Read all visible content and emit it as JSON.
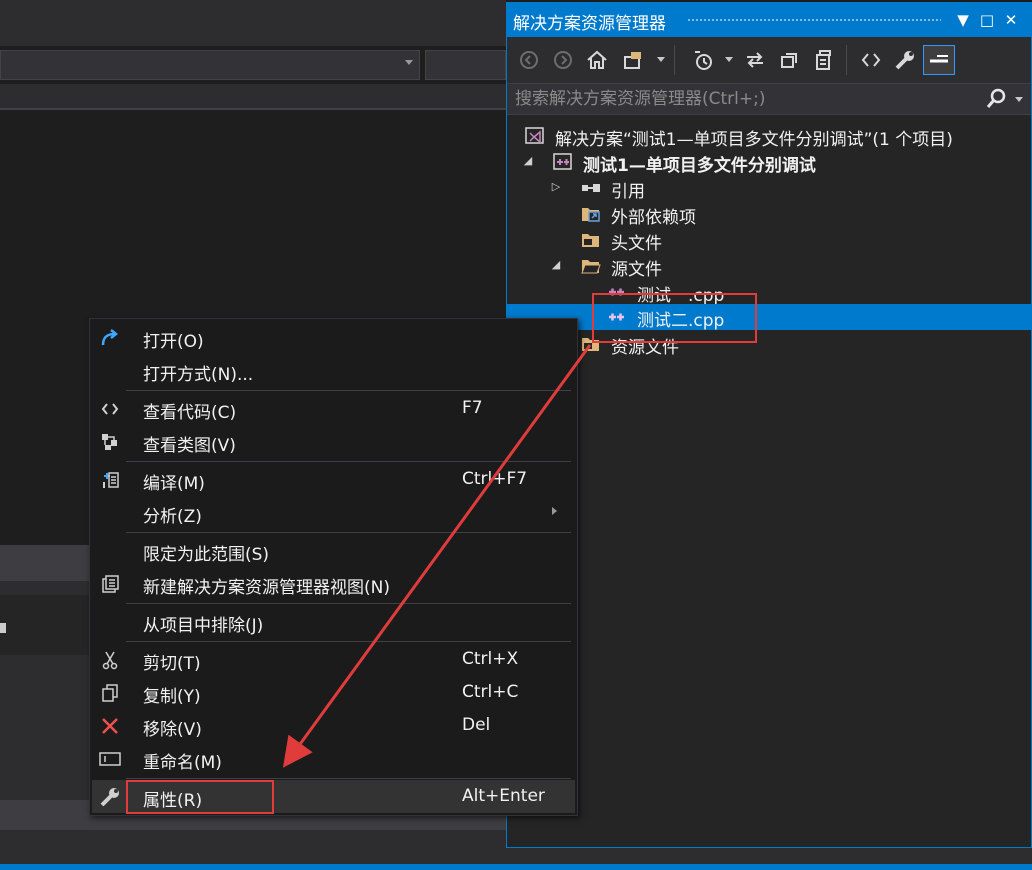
{
  "solution_explorer": {
    "title": "解决方案资源管理器",
    "title_buttons": [
      "▼",
      "□",
      "✕"
    ],
    "toolbar": {
      "buttons": [
        "back-icon",
        "forward-icon",
        "home-icon",
        "switch-views-icon",
        "pending-changes-icon",
        "sync-icon",
        "collapse-all-icon",
        "show-all-files-icon",
        "view-code-icon",
        "properties-icon",
        "preview-icon"
      ]
    },
    "search": {
      "placeholder": "搜索解决方案资源管理器(Ctrl+;)"
    },
    "tree": {
      "solution": "解决方案“测试1—单项目多文件分别调试”(1 个项目)",
      "project": "测试1—单项目多文件分别调试",
      "references": "引用",
      "external_deps": "外部依赖项",
      "header_files": "头文件",
      "source_files": "源文件",
      "file1": "测试一.cpp",
      "file2": "测试二.cpp",
      "resource_files": "资源文件"
    }
  },
  "context_menu": {
    "items": [
      {
        "label": "打开(O)",
        "shortcut": "",
        "icon": "open-icon"
      },
      {
        "label": "打开方式(N)...",
        "shortcut": "",
        "icon": ""
      },
      {
        "label": "查看代码(C)",
        "shortcut": "F7",
        "icon": "view-code-icon"
      },
      {
        "label": "查看类图(V)",
        "shortcut": "",
        "icon": "class-diagram-icon"
      },
      {
        "label": "编译(M)",
        "shortcut": "Ctrl+F7",
        "icon": "compile-icon"
      },
      {
        "label": "分析(Z)",
        "shortcut": "",
        "icon": ""
      },
      {
        "label": "限定为此范围(S)",
        "shortcut": "",
        "icon": ""
      },
      {
        "label": "新建解决方案资源管理器视图(N)",
        "shortcut": "",
        "icon": "new-view-icon"
      },
      {
        "label": "从项目中排除(J)",
        "shortcut": "",
        "icon": ""
      },
      {
        "label": "剪切(T)",
        "shortcut": "Ctrl+X",
        "icon": "cut-icon"
      },
      {
        "label": "复制(Y)",
        "shortcut": "Ctrl+C",
        "icon": "copy-icon"
      },
      {
        "label": "移除(V)",
        "shortcut": "Del",
        "icon": "remove-icon"
      },
      {
        "label": "重命名(M)",
        "shortcut": "",
        "icon": "rename-icon"
      },
      {
        "label": "属性(R)",
        "shortcut": "Alt+Enter",
        "icon": "properties-icon"
      }
    ]
  },
  "colors": {
    "accent": "#007acc",
    "annotation": "#e03c3c",
    "menu_bg": "#1b1b1c",
    "panel_bg": "#252526"
  }
}
